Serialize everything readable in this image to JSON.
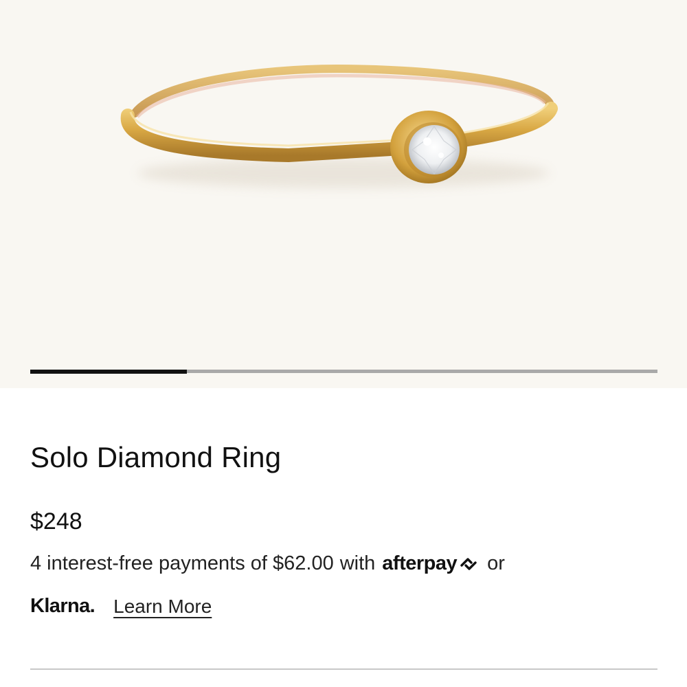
{
  "gallery": {
    "image_icon": "gold-bezel-diamond-ring",
    "progress_fraction": 0.25,
    "colors": {
      "background": "#f9f7f2",
      "track": "#a9a9a9",
      "fill": "#111111"
    }
  },
  "product": {
    "title": "Solo Diamond Ring",
    "price": "$248"
  },
  "payment": {
    "installment_text": "4 interest-free payments of $62.00",
    "with_text": "with",
    "afterpay_label": "afterpay",
    "or_text": "or",
    "klarna_label": "Klarna.",
    "learn_more_label": "Learn More"
  }
}
